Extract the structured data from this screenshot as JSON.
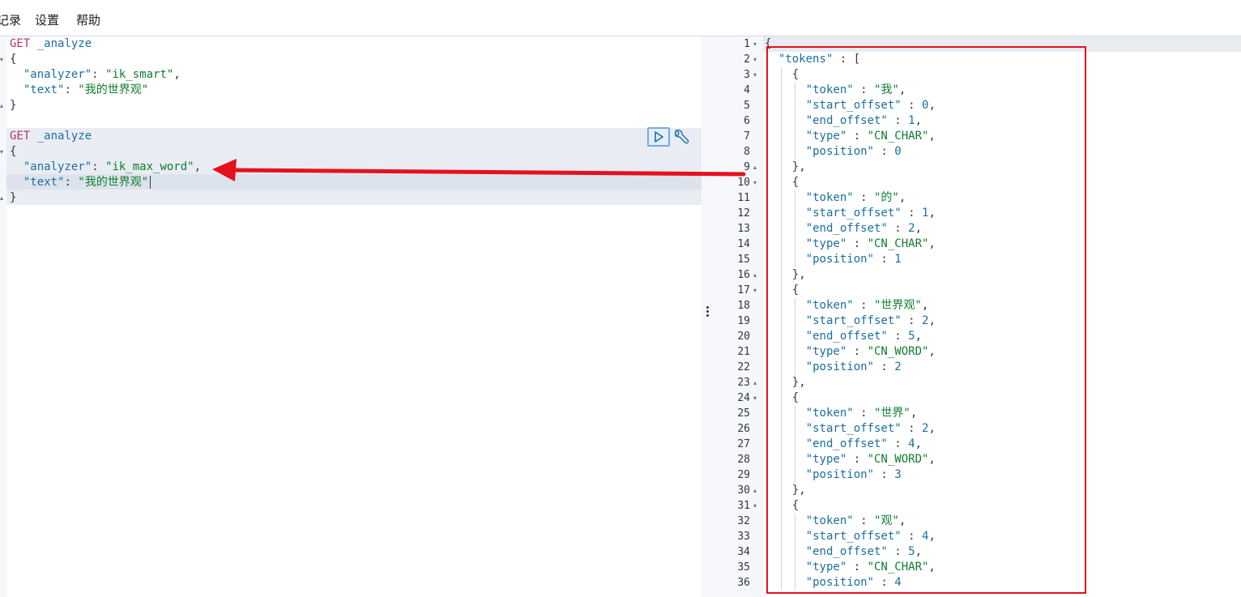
{
  "menu": {
    "history": "记录",
    "settings": "设置",
    "help": "帮助"
  },
  "request1": {
    "method": "GET",
    "path": "_analyze",
    "open_brace": "{",
    "analyzer_key": "\"analyzer\"",
    "analyzer_value": "\"ik_smart\"",
    "text_key": "\"text\"",
    "text_value": "\"我的世界观\"",
    "close_brace": "}"
  },
  "request2": {
    "method": "GET",
    "path": "_analyze",
    "open_brace": "{",
    "analyzer_key": "\"analyzer\"",
    "analyzer_value": "\"ik_max_word\"",
    "text_key": "\"text\"",
    "text_value": "\"我的世界观\"",
    "close_brace": "}"
  },
  "colors": {
    "annotation": "#e5111d",
    "method": "#b6336f",
    "key": "#1b6e9f",
    "string": "#0f7d2f"
  },
  "icons": {
    "run": "play-triangle-icon",
    "settings": "wrench-icon"
  },
  "response": {
    "line_numbers": [
      "1",
      "2",
      "3",
      "4",
      "5",
      "6",
      "7",
      "8",
      "9",
      "10",
      "11",
      "12",
      "13",
      "14",
      "15",
      "16",
      "17",
      "18",
      "19",
      "20",
      "21",
      "22",
      "23",
      "24",
      "25",
      "26",
      "27",
      "28",
      "29",
      "30",
      "31",
      "32",
      "33",
      "34",
      "35",
      "36"
    ],
    "tokens_key": "\"tokens\"",
    "tokens": [
      {
        "token": "\"我\"",
        "start_offset": "0",
        "end_offset": "1",
        "type": "\"CN_CHAR\"",
        "position": "0"
      },
      {
        "token": "\"的\"",
        "start_offset": "1",
        "end_offset": "2",
        "type": "\"CN_CHAR\"",
        "position": "1"
      },
      {
        "token": "\"世界观\"",
        "start_offset": "2",
        "end_offset": "5",
        "type": "\"CN_WORD\"",
        "position": "2"
      },
      {
        "token": "\"世界\"",
        "start_offset": "2",
        "end_offset": "4",
        "type": "\"CN_WORD\"",
        "position": "3"
      },
      {
        "token": "\"观\"",
        "start_offset": "4",
        "end_offset": "5",
        "type": "\"CN_CHAR\"",
        "position": "4"
      }
    ],
    "labels": {
      "token": "\"token\"",
      "start_offset": "\"start_offset\"",
      "end_offset": "\"end_offset\"",
      "type": "\"type\"",
      "position": "\"position\""
    }
  }
}
